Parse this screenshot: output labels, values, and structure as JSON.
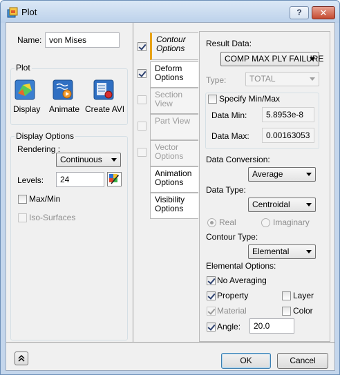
{
  "window": {
    "title": "Plot",
    "help_label": "?",
    "close_label": "✕"
  },
  "left": {
    "name_label": "Name:",
    "name_value": "von Mises",
    "plot_group_title": "Plot",
    "plot_buttons": [
      {
        "label": "Display"
      },
      {
        "label": "Animate"
      },
      {
        "label": "Create AVI"
      }
    ],
    "display_options": {
      "title": "Display Options",
      "rendering_label": "Rendering :",
      "rendering_value": "Continuous",
      "levels_label": "Levels:",
      "levels_value": "24",
      "maxmin_label": "Max/Min",
      "maxmin_checked": false,
      "isosurfaces_label": "Iso-Surfaces",
      "isosurfaces_checked": false
    }
  },
  "tabs": [
    {
      "label": "Contour Options",
      "checked": true,
      "active": true,
      "enabled": true
    },
    {
      "label": "Deform Options",
      "checked": true,
      "active": false,
      "enabled": true
    },
    {
      "label": "Section View",
      "checked": false,
      "active": false,
      "enabled": false
    },
    {
      "label": "Part View",
      "checked": false,
      "active": false,
      "enabled": false
    },
    {
      "label": "Vector Options",
      "checked": false,
      "active": false,
      "enabled": false
    },
    {
      "label": "Animation Options",
      "checked": null,
      "active": false,
      "enabled": true
    },
    {
      "label": "Visibility Options",
      "checked": null,
      "active": false,
      "enabled": true
    }
  ],
  "contour": {
    "result_data_label": "Result Data:",
    "result_data_value": "COMP MAX PLY FAILURE",
    "type_label": "Type:",
    "type_value": "TOTAL",
    "specify_minmax_label": "Specify Min/Max",
    "specify_minmax_checked": false,
    "data_min_label": "Data Min:",
    "data_min_value": "5.8953e-8",
    "data_max_label": "Data Max:",
    "data_max_value": "0.00163053",
    "data_conversion_label": "Data Conversion:",
    "data_conversion_value": "Average",
    "data_type_label": "Data Type:",
    "data_type_value": "Centroidal",
    "real_label": "Real",
    "imaginary_label": "Imaginary",
    "contour_type_label": "Contour Type:",
    "contour_type_value": "Elemental",
    "elemental_options_label": "Elemental Options:",
    "no_averaging_label": "No Averaging",
    "no_averaging_checked": true,
    "property_label": "Property",
    "property_checked": true,
    "layer_label": "Layer",
    "layer_checked": false,
    "material_label": "Material",
    "material_checked": true,
    "color_label": "Color",
    "color_checked": false,
    "angle_label": "Angle:",
    "angle_checked": true,
    "angle_value": "20.0"
  },
  "footer": {
    "ok_label": "OK",
    "cancel_label": "Cancel",
    "expand_icon": "double-chevron-up-icon"
  },
  "colors": {
    "accent_tab": "#e8a317",
    "titlebar": "#c4d6ec",
    "close": "#c44a30"
  }
}
